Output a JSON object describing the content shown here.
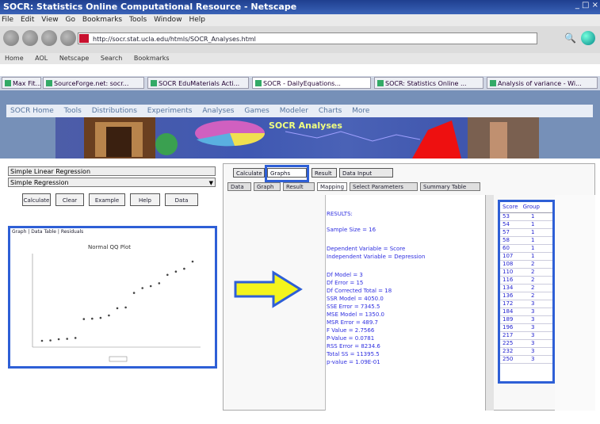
{
  "window": {
    "title": "SOCR: Statistics Online Computational Resource - Netscape",
    "controls": "_ □ ×"
  },
  "menu": [
    "File",
    "Edit",
    "View",
    "Go",
    "Bookmarks",
    "Tools",
    "Window",
    "Help"
  ],
  "nav": {
    "url": "http://socr.stat.ucla.edu/htmls/SOCR_Analyses.html"
  },
  "bookmarks": [
    "Home",
    "AOL",
    "Netscape",
    "Search",
    "Bookmarks"
  ],
  "browser_tabs": [
    "Max Fit...",
    "SourceForge.net: socr...",
    "SOCR EduMaterials Acti...",
    "SOCR - DailyEquations...",
    "SOCR: Statistics Online ...",
    "Analysis of variance - Wi..."
  ],
  "socr_nav": [
    "SOCR Home",
    "Tools",
    "Distributions",
    "Experiments",
    "Analyses",
    "Games",
    "Modeler",
    "Charts",
    "More"
  ],
  "banner": {
    "title": "SOCR Analyses"
  },
  "left": {
    "dropdown1": "Simple Linear Regression",
    "dropdown2": "Simple Regression",
    "buttons": [
      "Calculate",
      "Clear",
      "Example",
      "Help",
      "Data"
    ],
    "plot_tabs": "Graph | Data Table | Residuals",
    "plot_title": "Normal QQ Plot",
    "colors": {
      "highlight": "#2e5fd6"
    }
  },
  "right": {
    "main_tabs": [
      "Calculate",
      "Graphs",
      "Result",
      "Data Input"
    ],
    "sub_tabs": [
      "Data",
      "Graph",
      "Result",
      "Mapping",
      "Select Parameters",
      "Summary Table"
    ],
    "result_lines": [
      "RESULTS:",
      "Sample Size = 16",
      "Dependent Variable = Score",
      "Independent Variable = Depression",
      "Df Model = 3",
      "Df Error = 15",
      "Df Corrected Total = 18",
      "SSR Model = 4050.0",
      "SSE Error = 7345.5",
      "MSE Model = 1350.0",
      "MSR Error = 489.7",
      "F Value = 2.7566",
      "P-Value = 0.0781",
      "RSS Error = 8234.6",
      "Total SS = 11395.5",
      "p-value = 1.09E-01"
    ],
    "table": {
      "headers": [
        "Score",
        "Group"
      ],
      "rows": [
        [
          "53",
          "1"
        ],
        [
          "54",
          "1"
        ],
        [
          "57",
          "1"
        ],
        [
          "58",
          "1"
        ],
        [
          "60",
          "1"
        ],
        [
          "107",
          "1"
        ],
        [
          "108",
          "2"
        ],
        [
          "110",
          "2"
        ],
        [
          "116",
          "2"
        ],
        [
          "134",
          "2"
        ],
        [
          "136",
          "2"
        ],
        [
          "172",
          "3"
        ],
        [
          "184",
          "3"
        ],
        [
          "189",
          "3"
        ],
        [
          "196",
          "3"
        ],
        [
          "217",
          "3"
        ],
        [
          "225",
          "3"
        ],
        [
          "232",
          "3"
        ],
        [
          "250",
          "3"
        ]
      ]
    }
  }
}
